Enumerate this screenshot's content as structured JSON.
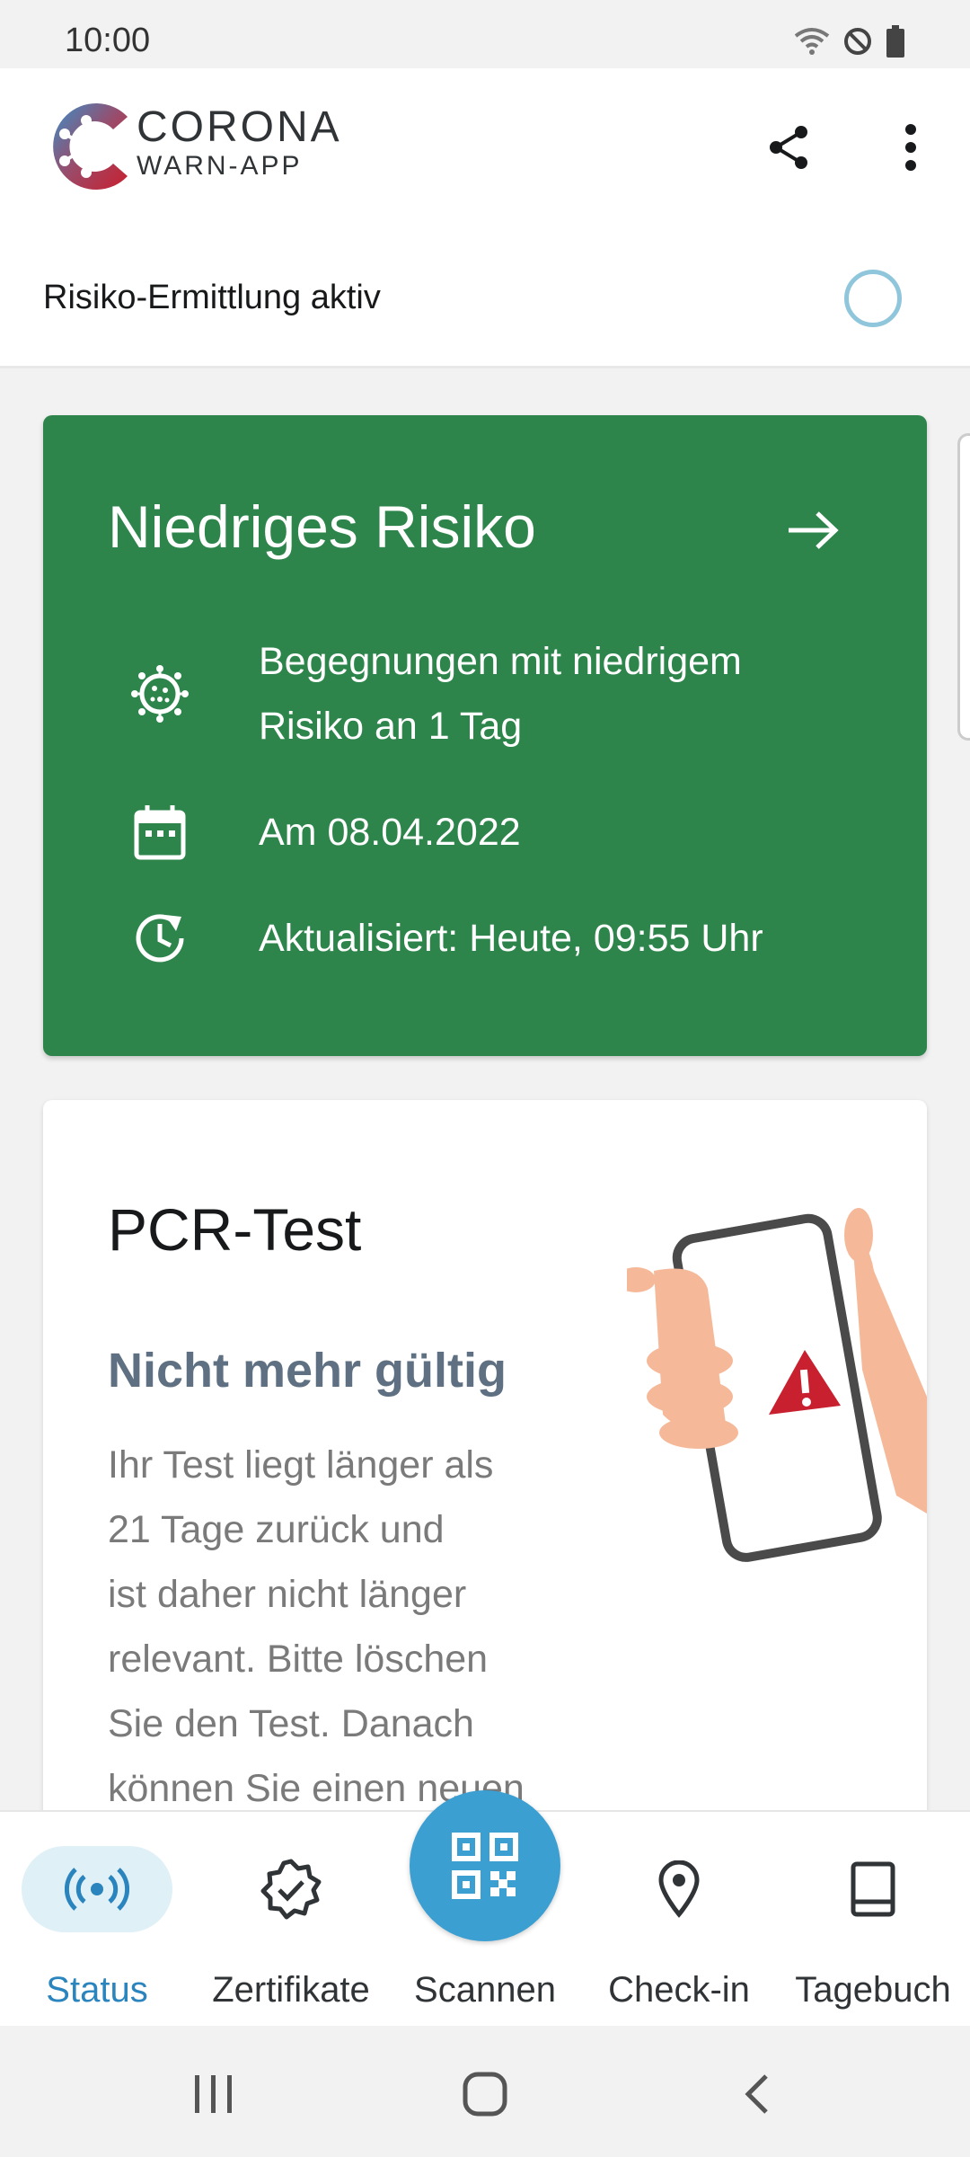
{
  "status_bar": {
    "time": "10:00",
    "icons": [
      "wifi-icon",
      "do-not-disturb-icon",
      "battery-icon"
    ]
  },
  "header": {
    "logo_title": "CORONA",
    "logo_subtitle": "WARN-APP",
    "actions": [
      "share-icon",
      "more-vert-icon"
    ]
  },
  "risk_status": {
    "label": "Risiko-Ermittlung aktiv"
  },
  "risk_card": {
    "title": "Niedriges Risiko",
    "encounters_line1": "Begegnungen mit niedrigem",
    "encounters_line2": "Risiko an 1 Tag",
    "date": "Am 08.04.2022",
    "updated": "Aktualisiert: Heute, 09:55 Uhr",
    "color": "#2e854b"
  },
  "pcr_card": {
    "title": "PCR-Test",
    "subtitle": "Nicht mehr gültig",
    "body_lines": [
      "Ihr Test liegt länger als",
      "21 Tage zurück und",
      "ist daher nicht länger",
      "relevant. Bitte löschen",
      "Sie den Test. Danach",
      "können Sie einen neuen"
    ]
  },
  "bottom_nav": {
    "items": [
      {
        "label": "Status",
        "icon": "radar-icon",
        "active": true
      },
      {
        "label": "Zertifikate",
        "icon": "certificate-icon",
        "active": false
      },
      {
        "label": "Scannen",
        "icon": "qr-code-icon",
        "active": false
      },
      {
        "label": "Check-in",
        "icon": "location-pin-icon",
        "active": false
      },
      {
        "label": "Tagebuch",
        "icon": "book-icon",
        "active": false
      }
    ],
    "accent": "#2a84bd"
  },
  "system_nav": [
    "recents-icon",
    "home-icon",
    "back-icon"
  ]
}
